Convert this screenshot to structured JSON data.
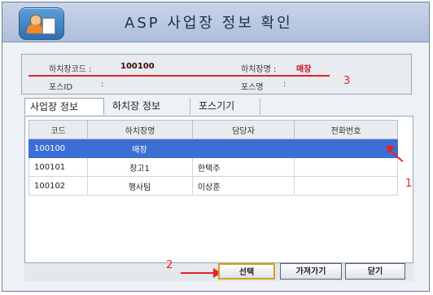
{
  "window": {
    "title": "ASP 사업장 정보 확인"
  },
  "info": {
    "code_label": "하치장코드 :",
    "code_value": "100100",
    "name_label": "하치장명 :",
    "name_value": "매장",
    "pos_id_label": "포스ID",
    "pos_id_sep": ":",
    "pos_name_label": "포스명",
    "pos_name_sep": ":"
  },
  "tabs": [
    {
      "label": "사업장 정보",
      "active": true
    },
    {
      "label": "하치장 정보",
      "active": false
    },
    {
      "label": "포스기기",
      "active": false
    }
  ],
  "table": {
    "columns": [
      "코드",
      "하치장명",
      "담당자",
      "전화번호"
    ],
    "rows": [
      {
        "code": "100100",
        "name": "매장",
        "manager": "",
        "phone": "",
        "selected": true
      },
      {
        "code": "100101",
        "name": "창고1",
        "manager": "한택주",
        "phone": "",
        "selected": false
      },
      {
        "code": "100102",
        "name": "행사팀",
        "manager": "이상훈",
        "phone": "",
        "selected": false
      }
    ]
  },
  "buttons": {
    "select": "선택",
    "import": "가져가기",
    "close": "닫기"
  },
  "annotations": {
    "a1": "1",
    "a2": "2",
    "a3": "3"
  },
  "colors": {
    "accent": "#3c6fd4",
    "annotation": "#e3242b",
    "value_text": "#c8102e"
  }
}
